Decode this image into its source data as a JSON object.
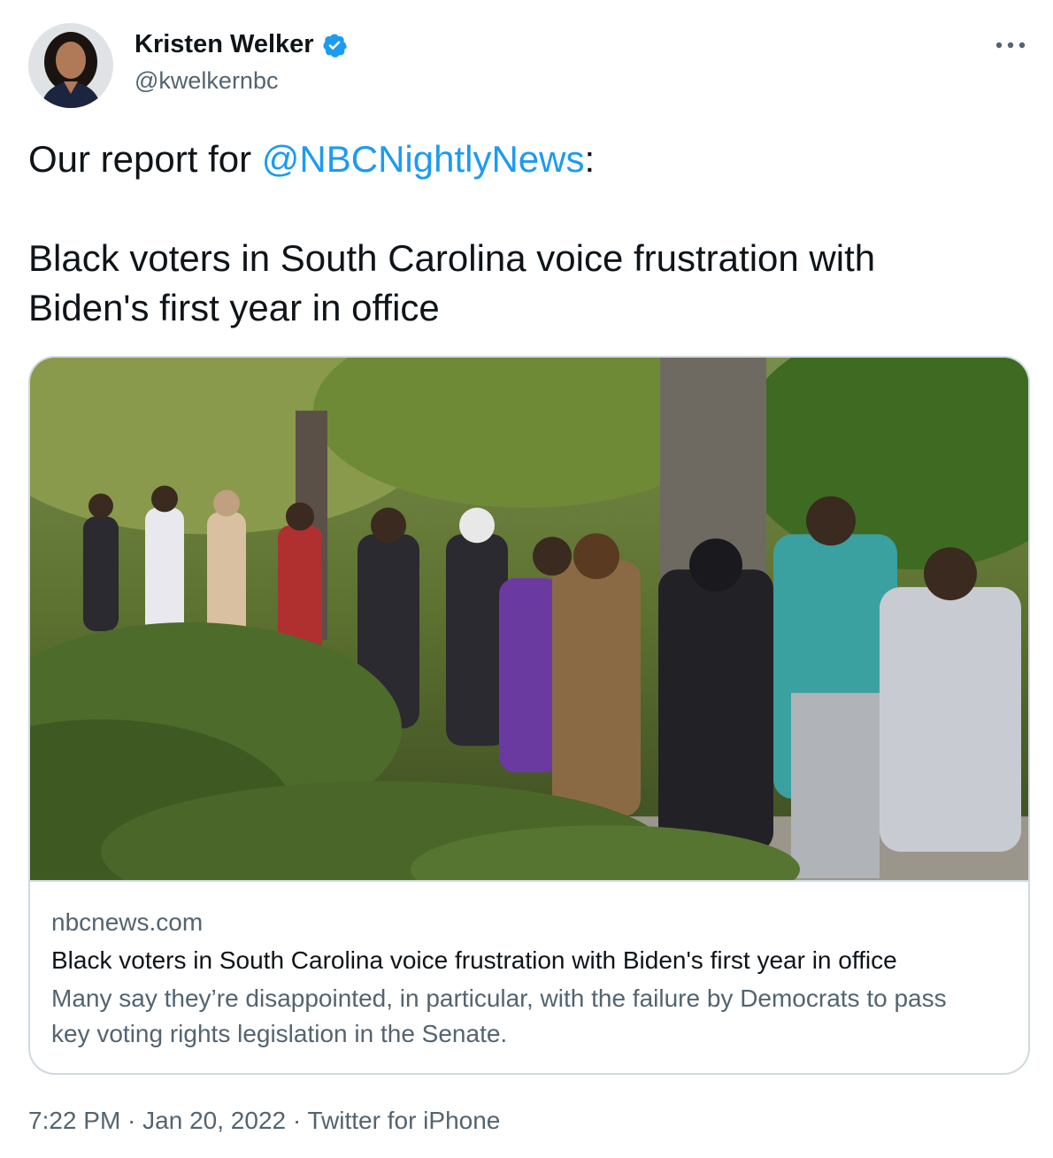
{
  "author": {
    "display_name": "Kristen Welker",
    "handle": "@kwelkernbc",
    "verified": true,
    "avatar_icon": "avatar"
  },
  "more_icon": "more-icon",
  "tweet": {
    "prefix": "Our report for ",
    "mention": "@NBCNightlyNews",
    "suffix": ":",
    "line2": "Black voters in South Carolina voice frustration with",
    "line3": "Biden's first year in office"
  },
  "card": {
    "image_icon": "news-photo",
    "domain": "nbcnews.com",
    "title": "Black voters in South Carolina voice frustration with Biden's first year in office",
    "description": "Many say they’re disappointed, in particular, with the failure by Democrats to pass key voting rights legislation in the Senate."
  },
  "meta": {
    "time": "7:22 PM",
    "sep1": " · ",
    "date": "Jan 20, 2022",
    "sep2": " · ",
    "source": "Twitter for iPhone"
  },
  "colors": {
    "accent": "#1d9bf0",
    "secondary_text": "#536471",
    "border": "#cfd9de"
  }
}
